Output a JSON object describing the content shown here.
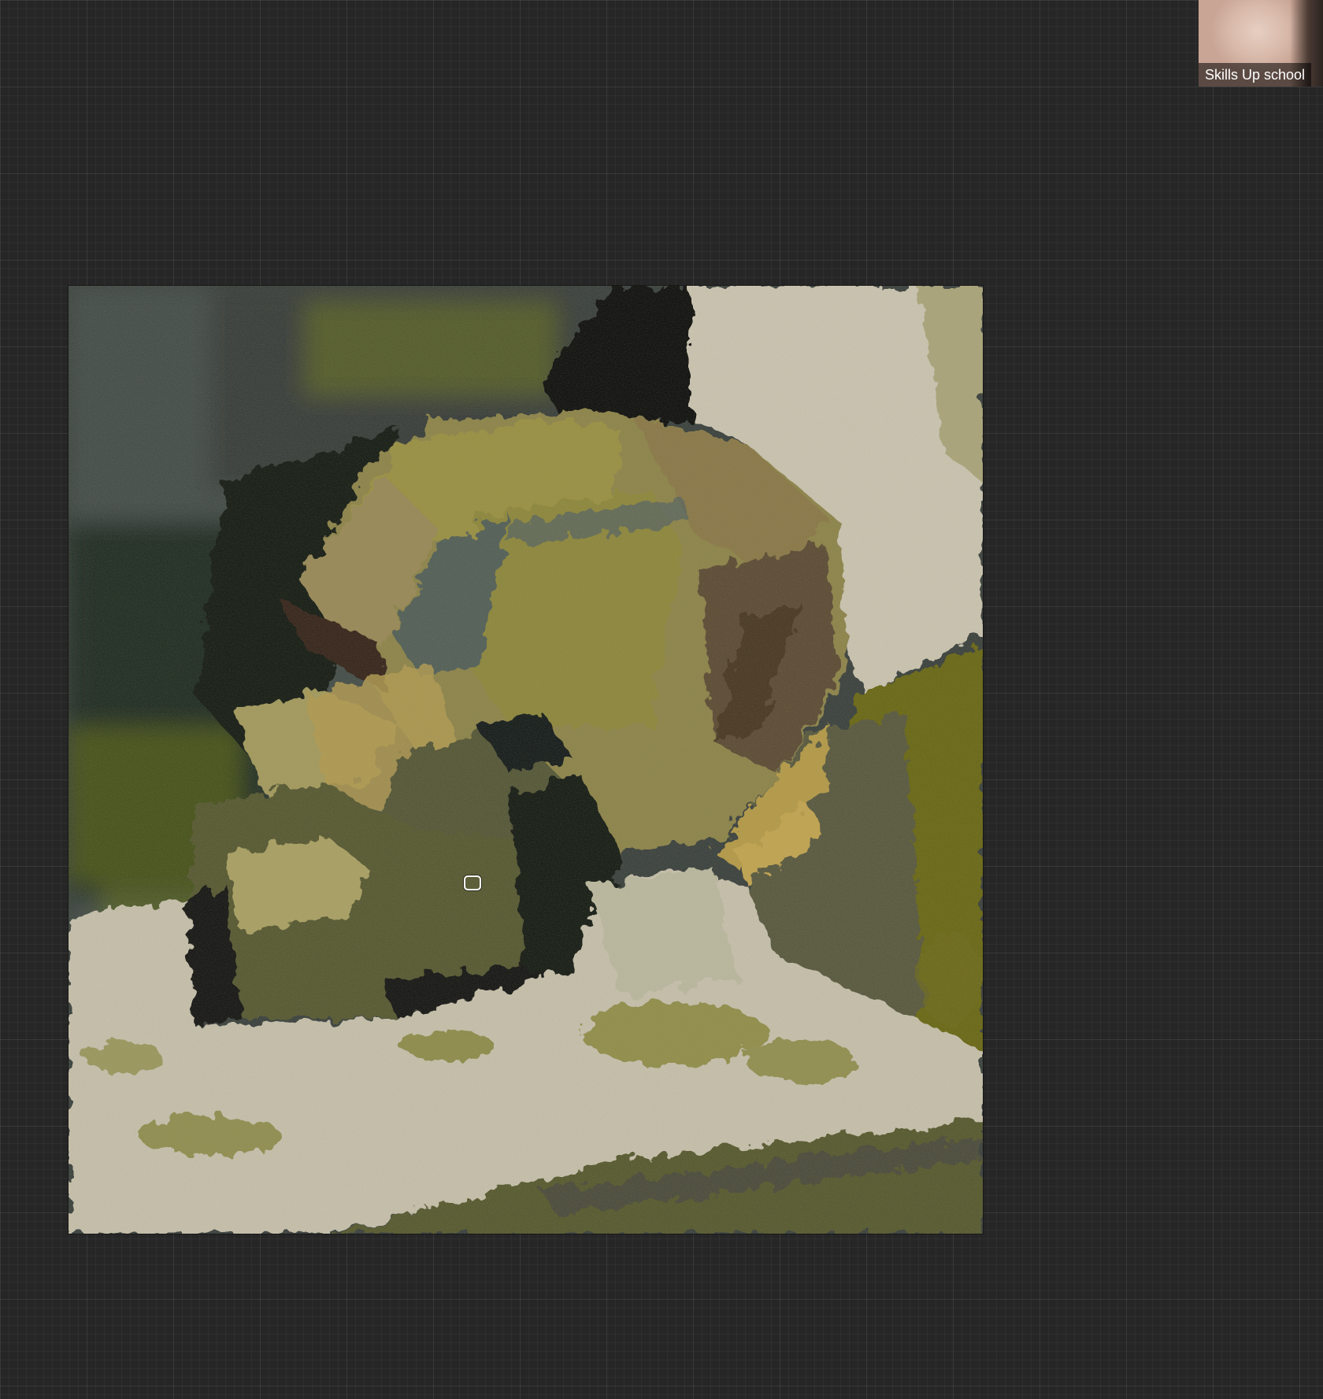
{
  "participant": {
    "name": "Skills Up school"
  },
  "canvas": {
    "palette": {
      "background": "#262626",
      "olive": "#6e6a1c",
      "khaki": "#9e9246",
      "tan": "#8a7a4e",
      "brown": "#5a4a34",
      "darkbrown": "#3b2d22",
      "slate": "#4c5453",
      "charcoal": "#2e3230",
      "black": "#151515",
      "cream": "#c9c4b4",
      "ochre": "#b99b4a",
      "greygreen": "#5b5f44"
    }
  },
  "cursor": {
    "icon": "brush-cursor-icon"
  }
}
